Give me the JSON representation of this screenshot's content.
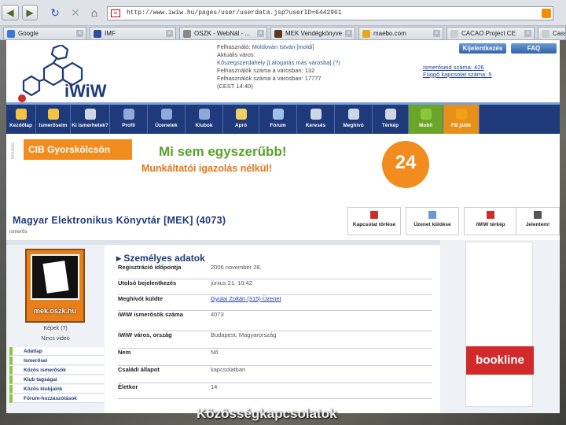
{
  "browser": {
    "url": "http://www.iwiw.hu/pages/user/userdata.jsp?userID=6442961",
    "favicon": "w",
    "tabs": [
      {
        "label": "Google",
        "color": "#3a78d8"
      },
      {
        "label": "IMF",
        "color": "#2a4fa0"
      },
      {
        "label": "OSZK - WebNál - ...",
        "color": "#888888"
      },
      {
        "label": "MEK Vendégkönyve",
        "color": "#5a3a1a"
      },
      {
        "label": "maebo.com",
        "color": "#e8a81c"
      },
      {
        "label": "CACAO Project CE",
        "color": "#cccccc"
      },
      {
        "label": "Cass",
        "color": "#cccccc"
      }
    ]
  },
  "site": {
    "logo_text": "iWiW",
    "user": {
      "line1_label": "Felhasználó:",
      "line1_value": "Moldován István [moldi]",
      "line2": "Aktuális város:",
      "line3": "Kőszegszerdahely [Látogatás más városba] (?)",
      "line4": "Felhasználók száma a városban: 132",
      "line5": "Felhasználók száma a városban: 17777",
      "line6": "(CEST 14:40)"
    },
    "right": {
      "line1": "Ismerőseid száma: 426",
      "line2": "Függő kapcsolat száma: 5"
    },
    "buttons": {
      "logout": "Kijelentkezés",
      "faq": "FAQ"
    },
    "menu": [
      {
        "label": "Kezdőlap",
        "color": "#f5c342"
      },
      {
        "label": "Ismerőseim",
        "color": "#f5c342"
      },
      {
        "label": "Ki ismerhetek?",
        "color": "#cfd6e4"
      },
      {
        "label": "Profil",
        "color": "#8fa9d8"
      },
      {
        "label": "Üzenetek",
        "color": "#8fa9d8"
      },
      {
        "label": "Klubok",
        "color": "#8fa9d8"
      },
      {
        "label": "Apró",
        "color": "#f0d060"
      },
      {
        "label": "Fórum",
        "color": "#9ec0e8"
      },
      {
        "label": "Keresés",
        "color": "#cfd6e4"
      },
      {
        "label": "Meghívó",
        "color": "#cfd6e4"
      },
      {
        "label": "Térkép",
        "color": "#cfd6e4"
      },
      {
        "label": "Mobil",
        "color": "#8cc63f"
      },
      {
        "label": "FB játék",
        "color": "#f2a01c"
      }
    ],
    "banner": {
      "brand": "CIB Gyorskölcsön",
      "line1": "Mi sem egyszerűbb!",
      "line2": "Munkáltatói igazolás nélkül!",
      "badge": "24",
      "side": "hirdetés"
    },
    "profile": {
      "title": "Magyar Elektronikus Könyvtár [MEK] (4073)",
      "subtitle": "ismerős",
      "actions": [
        {
          "label": "Kapcsolat törlése",
          "icon_color": "#d02a2a"
        },
        {
          "label": "Üzenet küldése",
          "icon_color": "#6a9ad4"
        },
        {
          "label": "iWiW térkép",
          "icon_color": "#d02a2a"
        },
        {
          "label": "Jelentem!",
          "icon_color": "#555555"
        }
      ],
      "avatar_label": "mek.oszk.hu",
      "caption": "Képek (?)",
      "caption2": "Nincs videó",
      "left_nav": [
        "Adatlap",
        "Ismerősei",
        "Közös ismerősök",
        "Klub tagságai",
        "Közös klubjaink",
        "Fórum-hozzászólások"
      ],
      "section_title": "Személyes adatok",
      "rows": [
        {
          "key": "Regisztráció időpontja",
          "value": "2006 november 28."
        },
        {
          "key": "Utolsó bejelentkezés",
          "value": "június 21. 10:42"
        },
        {
          "key": "Meghívót küldte",
          "value": "Gyulai Zoltán (315) Üzenet",
          "link": true
        },
        {
          "key": "iWiW ismerősök száma",
          "value": "4073"
        },
        {
          "key": "iWiW város, ország",
          "value": "Budapest, Magyarország"
        },
        {
          "key": "Nem",
          "value": "Nő"
        },
        {
          "key": "Családi állapot",
          "value": "kapcsolatban"
        },
        {
          "key": "Életkor",
          "value": "14"
        }
      ],
      "ad_brand": "bookline"
    },
    "overlay_text": "Közösségkapcsolatok"
  }
}
